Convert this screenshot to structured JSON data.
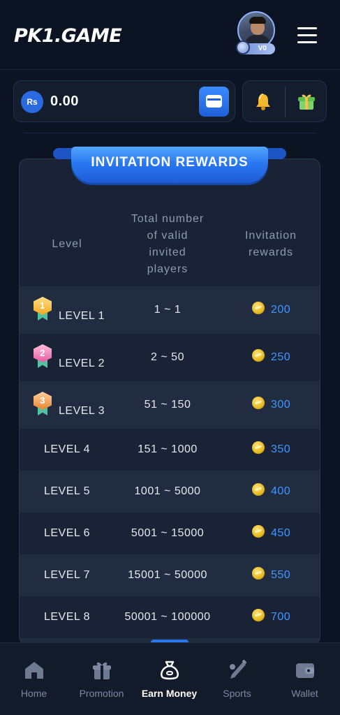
{
  "brand": {
    "logo_left": "PK",
    "logo_one": "1",
    "logo_right": ".GAME"
  },
  "user": {
    "vip_label": "V0"
  },
  "balance": {
    "currency_label": "Rs",
    "amount": "0.00"
  },
  "colors": {
    "accent": "#2a78f0",
    "background": "#0c1423",
    "panel": "#1a2335",
    "reward_text": "#3f96ff",
    "coin": "#e6b91c"
  },
  "icons": {
    "notifications": "bell-icon",
    "gift": "gift-icon",
    "menu": "hamburger-icon",
    "wallet_action": "card-icon"
  },
  "rewards": {
    "title": "INVITATION REWARDS",
    "columns": {
      "level": "Level",
      "players": "Total number\nof valid\ninvited\nplayers",
      "reward": "Invitation\nrewards"
    },
    "rows": [
      {
        "level": "LEVEL 1",
        "range": "1 ~ 1",
        "reward": "200",
        "medal": "1"
      },
      {
        "level": "LEVEL 2",
        "range": "2 ~ 50",
        "reward": "250",
        "medal": "2"
      },
      {
        "level": "LEVEL 3",
        "range": "51 ~ 150",
        "reward": "300",
        "medal": "3"
      },
      {
        "level": "LEVEL 4",
        "range": "151 ~ 1000",
        "reward": "350"
      },
      {
        "level": "LEVEL 5",
        "range": "1001 ~ 5000",
        "reward": "400"
      },
      {
        "level": "LEVEL 6",
        "range": "5001 ~ 15000",
        "reward": "450"
      },
      {
        "level": "LEVEL 7",
        "range": "15001 ~ 50000",
        "reward": "550"
      },
      {
        "level": "LEVEL 8",
        "range": "50001 ~ 100000",
        "reward": "700"
      }
    ]
  },
  "nav": {
    "items": [
      {
        "label": "Home",
        "icon": "home-icon"
      },
      {
        "label": "Promotion",
        "icon": "gift-icon"
      },
      {
        "label": "Earn Money",
        "icon": "money-bag-icon",
        "active": true
      },
      {
        "label": "Sports",
        "icon": "cricket-icon"
      },
      {
        "label": "Wallet",
        "icon": "wallet-icon"
      }
    ]
  }
}
